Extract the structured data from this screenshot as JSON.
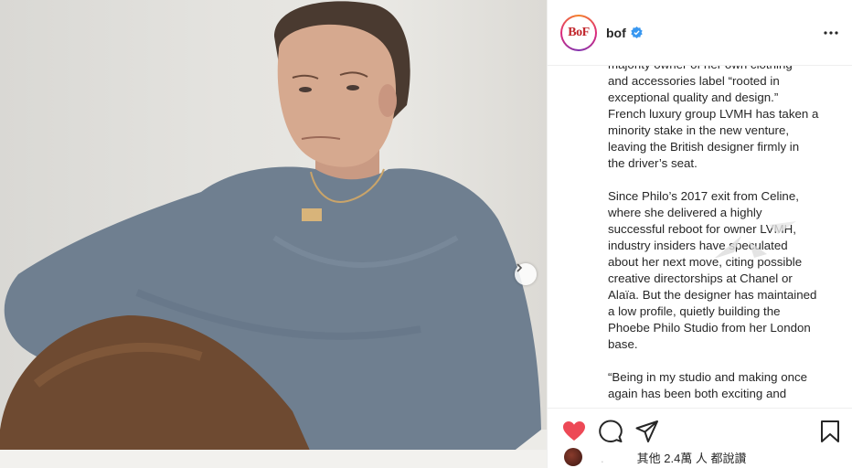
{
  "post": {
    "username": "bof",
    "avatar_text": "BoF",
    "icons": {
      "verified": "verified-badge-icon",
      "more": "more-options-icon",
      "next": "chevron-right-icon",
      "like": "heart-icon",
      "comment": "comment-icon",
      "share": "share-icon",
      "save": "bookmark-icon"
    },
    "colors": {
      "like": "#ed4956",
      "verified": "#3897f0",
      "brand": "#c1272d"
    }
  },
  "caption": {
    "paragraphs": [
      [
        "majority owner of her own clothing",
        "and accessories label “rooted in",
        "exceptional quality and design.”",
        "French luxury group LVMH has taken a",
        "minority stake in the new venture,",
        "leaving the British designer firmly in",
        "the driver’s seat."
      ],
      [
        "Since Philo’s 2017 exit from Celine,",
        "where she delivered a highly",
        "successful reboot for owner LVMH,",
        "industry insiders have speculated",
        "about her next move, citing possible",
        "creative directorships at Chanel or",
        "Alaïa. But the designer has maintained",
        "a low profile, quietly building the",
        "Phoebe Philo Studio from her London",
        "base."
      ],
      [
        "“Being in my studio and making once",
        "again has been both exciting and"
      ]
    ]
  },
  "likes": {
    "name": ".",
    "text": "其他 2.4萬 人 都說讚"
  }
}
